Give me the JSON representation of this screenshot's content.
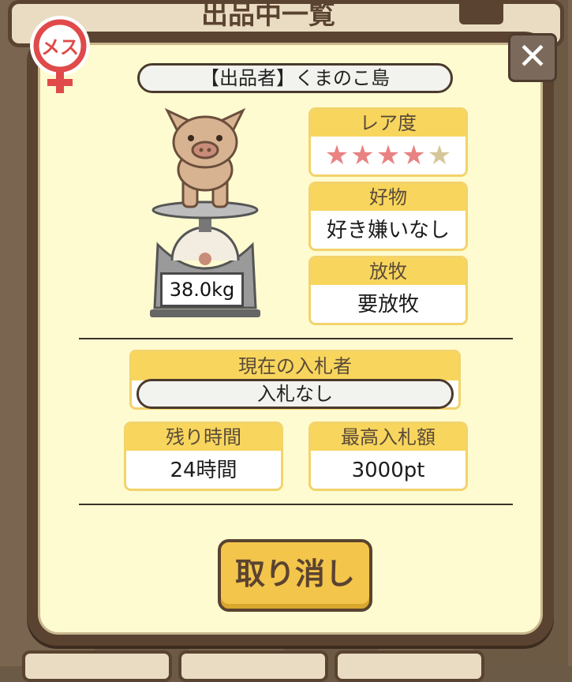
{
  "seller": {
    "label": "【出品者】くまのこ島"
  },
  "gender": {
    "label": "メス",
    "color": "#e04a4a"
  },
  "pig": {
    "weight": "38.0kg"
  },
  "rarity": {
    "label": "レア度",
    "stars_filled": 4,
    "stars_total": 5,
    "star_color_on": "#e98282",
    "star_color_off": "#d6c79a"
  },
  "preference": {
    "label": "好物",
    "value": "好き嫌いなし"
  },
  "grazing": {
    "label": "放牧",
    "value": "要放牧"
  },
  "bidder": {
    "label": "現在の入札者",
    "value": "入札なし"
  },
  "time_left": {
    "label": "残り時間",
    "value": "24時間"
  },
  "max_bid": {
    "label": "最高入札額",
    "value": "3000pt"
  },
  "cancel_button": {
    "label": "取り消し"
  },
  "close_button": {
    "label": "✕"
  },
  "bg_title": "出品中一覧"
}
